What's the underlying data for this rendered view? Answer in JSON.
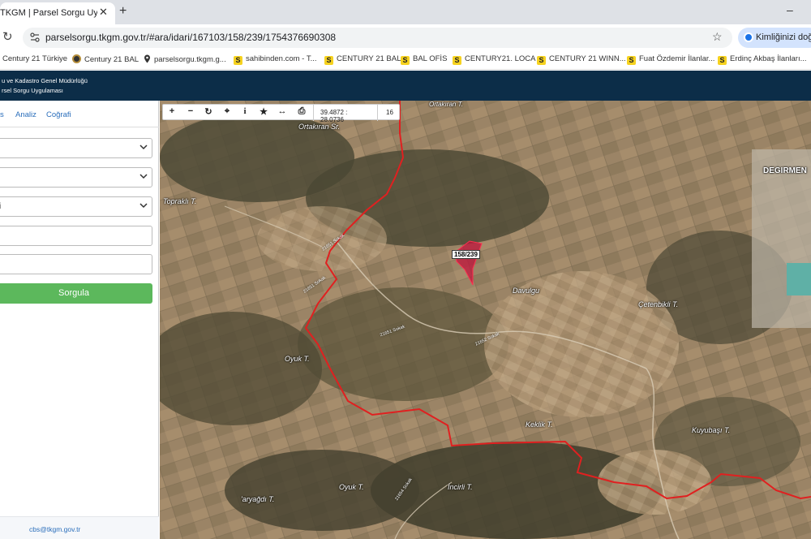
{
  "browser": {
    "tab_title": "TKGM | Parsel Sorgu Uygulaması",
    "tab_close": "✕",
    "new_tab": "+",
    "minimize": "–",
    "url": "parselsorgu.tkgm.gov.tr/#ara/idari/167103/158/239/1754376690308",
    "profile_label": "Kimliğinizi doğrulayın"
  },
  "bookmarks": [
    {
      "label": "Century 21 Türkiye",
      "icon": "none"
    },
    {
      "label": "Century 21 BAL",
      "icon": "century-icon"
    },
    {
      "label": "parselsorgu.tkgm.g...",
      "icon": "pin-icon"
    },
    {
      "label": "sahibinden.com - T...",
      "icon": "sahibinden-icon"
    },
    {
      "label": "CENTURY 21 BAL",
      "icon": "sahibinden-icon"
    },
    {
      "label": "BAL OFİS",
      "icon": "sahibinden-icon"
    },
    {
      "label": "CENTURY21. LOCA",
      "icon": "sahibinden-icon"
    },
    {
      "label": "CENTURY 21 WINN...",
      "icon": "sahibinden-icon"
    },
    {
      "label": "Fuat Özdemir İlanlar...",
      "icon": "sahibinden-icon"
    },
    {
      "label": "Erdinç Akbaş İlanları...",
      "icon": "sahibinden-icon"
    }
  ],
  "app_header": {
    "line1": "u ve Kadastro Genel Müdürlüğü",
    "line2": "rsel Sorgu Uygulaması"
  },
  "panel": {
    "tabs": [
      "s",
      "Analiz",
      "Coğrafi"
    ],
    "select3_value": "i",
    "submit_label": "Sorgula",
    "footer_email": "cbs@tkgm.gov.tr"
  },
  "map_toolbar": {
    "zoom_in": "+",
    "zoom_out": "−",
    "refresh": "↻",
    "locate": "⌖",
    "info": "i",
    "favorite": "★",
    "measure": "↔",
    "print": "⎙",
    "coordinates": "39.4872 : 28.0736",
    "zoom_level": "16"
  },
  "map_labels": {
    "ortakiran_top": "Ortakıran T.",
    "ortakiran_sr": "Ortakıran Sr.",
    "toprakli": "Topraklı T.",
    "degirmen": "DEGIRMEN",
    "davulgu": "Davulgu",
    "cetenbikli": "Çetenbikli T.",
    "oyuk1": "Oyuk T.",
    "oyuk2": "Oyuk T.",
    "keklik": "Keklik T.",
    "kuyubasi": "Kuyubaşı T.",
    "incirli": "İncirli T.",
    "yagdi": "'aryağdı T.",
    "parcel_id": "158/239",
    "road1": "21651 Sokak",
    "road2": "21651 Sokak",
    "road3": "21651 Sokak",
    "road4": "21652 Sokak",
    "road5": "21654 Sokak"
  },
  "colors": {
    "header_bg": "#0c2d48",
    "submit_bg": "#5cb85c",
    "boundary": "#e02020",
    "parcel_fill": "#c0143c"
  }
}
